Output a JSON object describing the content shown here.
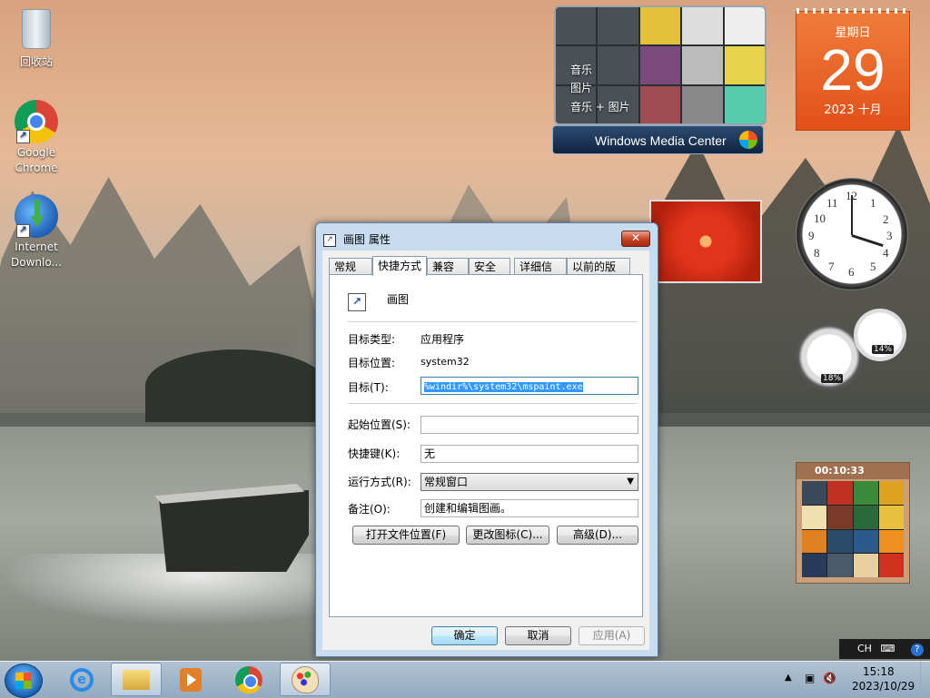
{
  "desktop": {
    "icons": [
      {
        "label": "回收站",
        "icon": "recycle-bin-icon"
      },
      {
        "label": "Google Chrome",
        "icon": "chrome-icon"
      },
      {
        "label": "Internet Downlo...",
        "icon": "internet-download-manager-icon"
      }
    ]
  },
  "gadgets": {
    "media_center": {
      "items": [
        "音乐",
        "图片",
        "音乐 + 图片"
      ],
      "bar_label": "Windows Media Center"
    },
    "calendar": {
      "day_of_week": "星期日",
      "day": "29",
      "year_month": "2023 十月"
    },
    "cpu_meter": {
      "cpu": "18%",
      "memory": "14%"
    },
    "puzzle": {
      "timer": "00:10:33"
    },
    "clock": {
      "numbers": [
        "12",
        "1",
        "2",
        "3",
        "4",
        "5",
        "6",
        "7",
        "8",
        "9",
        "10",
        "11"
      ]
    }
  },
  "dialog": {
    "title": "画图 属性",
    "close_label": "✕",
    "tabs": [
      "常规",
      "快捷方式",
      "兼容性",
      "安全",
      "详细信息",
      "以前的版本"
    ],
    "active_tab": "快捷方式",
    "shortcut_name": "画图",
    "fields": {
      "target_type_label": "目标类型:",
      "target_type_value": "应用程序",
      "target_location_label": "目标位置:",
      "target_location_value": "system32",
      "target_label": "目标(T):",
      "target_value": "%windir%\\system32\\mspaint.exe",
      "start_in_label": "起始位置(S):",
      "start_in_value": "",
      "hotkey_label": "快捷键(K):",
      "hotkey_value": "无",
      "run_label": "运行方式(R):",
      "run_value": "常规窗口",
      "comment_label": "备注(O):",
      "comment_value": "创建和编辑图画。"
    },
    "buttons": {
      "open_location": "打开文件位置(F)",
      "change_icon": "更改图标(C)...",
      "advanced": "高级(D)...",
      "ok": "确定",
      "cancel": "取消",
      "apply": "应用(A)"
    }
  },
  "language_bar": {
    "lang": "CH",
    "help": "?"
  },
  "taskbar": {
    "apps": [
      {
        "name": "internet-explorer-icon"
      },
      {
        "name": "file-explorer-icon"
      },
      {
        "name": "media-player-icon"
      },
      {
        "name": "chrome-icon"
      },
      {
        "name": "paint-icon"
      }
    ],
    "time": "15:18",
    "date": "2023/10/29"
  },
  "colors": {
    "calendar": "#e2501a",
    "close": "#c2401f",
    "selection": "#3399ff"
  }
}
